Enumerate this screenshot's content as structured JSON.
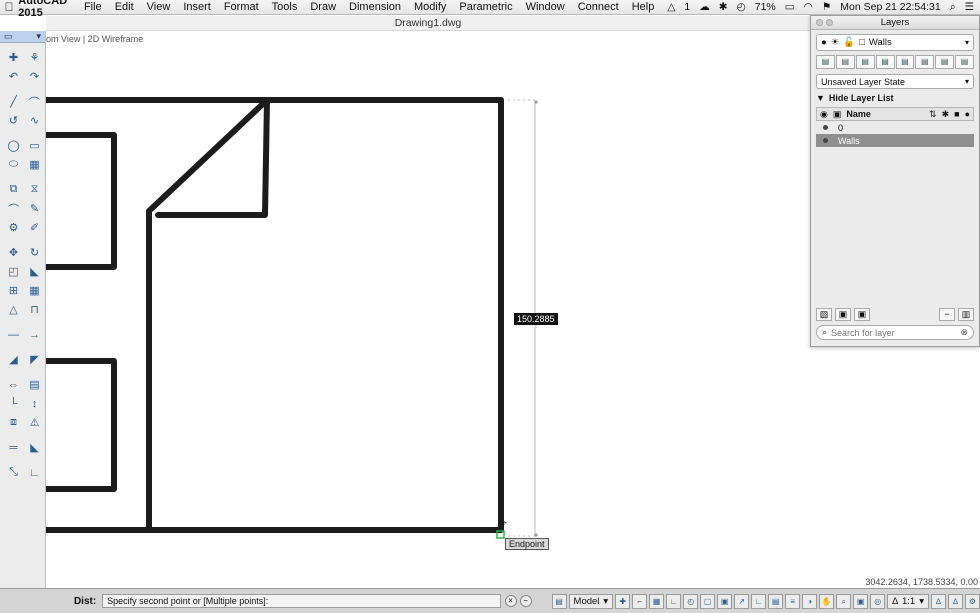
{
  "menubar": {
    "apple_icon": "apple-icon",
    "app_name": "AutoCAD 2015",
    "items": [
      "File",
      "Edit",
      "View",
      "Insert",
      "Format",
      "Tools",
      "Draw",
      "Dimension",
      "Modify",
      "Parametric",
      "Window",
      "Connect",
      "Help"
    ],
    "status": {
      "adobe_badge": "1",
      "battery": "71%",
      "datetime": "Mon Sep 21  22:54:31"
    }
  },
  "document": {
    "title": "Drawing1.dwg"
  },
  "viewport": {
    "label": "om View | 2D Wireframe"
  },
  "canvas": {
    "dimension_tooltip": "150.2885",
    "snap_tooltip": "Endpoint",
    "coordinates": "3042.2634, 1738.5334, 0.00"
  },
  "layers_panel": {
    "title": "Layers",
    "current_layer": "Walls",
    "layer_state": "Unsaved Layer State",
    "hide_list_label": "Hide Layer List",
    "column_name": "Name",
    "layers": [
      {
        "name": "0",
        "selected": false
      },
      {
        "name": "Walls",
        "selected": true
      }
    ],
    "search_placeholder": "Search for layer"
  },
  "command_line": {
    "label": "Dist:",
    "prompt": "Specify second point or [Multiple points]:"
  },
  "status_bar": {
    "model_label": "Model",
    "scale_label": "1:1"
  },
  "colors": {
    "line": "#1c1c1c",
    "snap_marker": "#2bb64a",
    "toolbar_accent": "#2a5d8f"
  }
}
